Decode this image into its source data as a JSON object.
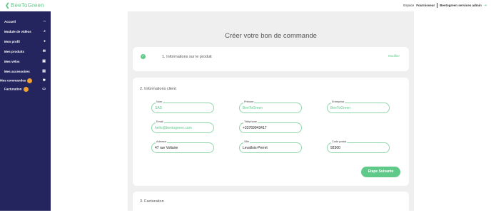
{
  "header": {
    "logo_text": "BeeToGreen",
    "space_prefix": "Espace",
    "space_name": "Fournisseur",
    "user_name": "Beetogreen services admin",
    "logout_icon": "logout-icon"
  },
  "sidebar": {
    "items": [
      {
        "label": "Accueil",
        "icon": "home-icon"
      },
      {
        "label": "Module de vidéos",
        "icon": "search-icon"
      },
      {
        "label": "Mon profil",
        "icon": "user-icon"
      },
      {
        "label": "Mes produits",
        "icon": "mail-icon"
      },
      {
        "label": "Mes vélos",
        "icon": "lock-icon"
      },
      {
        "label": "Mes accessoires",
        "icon": "briefcase-icon"
      },
      {
        "label": "Mes commandes",
        "icon": "gear-icon",
        "badge": true
      },
      {
        "label": "Facturation",
        "icon": "card-icon",
        "badge": true
      }
    ],
    "badge_color": "#f0a030"
  },
  "main": {
    "title": "Créer votre bon de commande",
    "step1": {
      "title": "1. Informations sur le produit",
      "action": "Modifier"
    },
    "step2": {
      "title": "2. Informations client",
      "fields": [
        {
          "label": "Nom",
          "value": "SAS",
          "placeholder": true
        },
        {
          "label": "Prénom",
          "value": "BeeToGreen",
          "placeholder": true
        },
        {
          "label": "Entreprise",
          "value": "BeeToGreen",
          "placeholder": true
        },
        {
          "label": "Email",
          "value": "hello@beetogreen.com",
          "placeholder": true
        },
        {
          "label": "Téléphone",
          "value": "+33769943417",
          "placeholder": false
        },
        {
          "label": "Adresse",
          "value": "47 rue Voltaire",
          "placeholder": false
        },
        {
          "label": "Ville",
          "value": "Levallois-Perret",
          "placeholder": false
        },
        {
          "label": "Code postal",
          "value": "92300",
          "placeholder": false
        }
      ],
      "next_button": "Etape Suivante"
    },
    "step3": {
      "title": "3. Facturation"
    }
  },
  "colors": {
    "sidebar": "#24245e",
    "accent": "#5fc98a",
    "background": "#efefef"
  }
}
